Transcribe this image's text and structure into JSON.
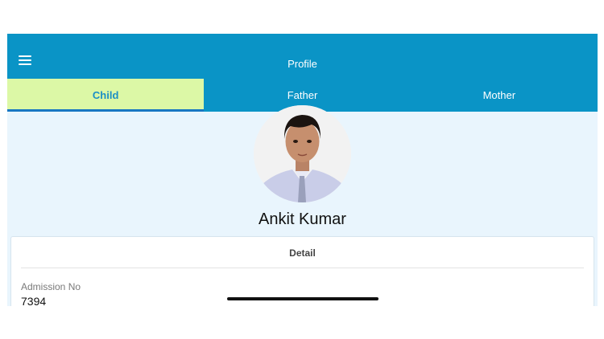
{
  "appbar": {
    "title": "Profile",
    "menu_icon": "hamburger-menu-icon"
  },
  "tabs": [
    {
      "label": "Child",
      "active": true
    },
    {
      "label": "Father",
      "active": false
    },
    {
      "label": "Mother",
      "active": false
    }
  ],
  "profile": {
    "name": "Ankit Kumar"
  },
  "detail_card": {
    "title": "Detail",
    "fields": [
      {
        "label": "Admission No",
        "value": "7394"
      }
    ]
  },
  "colors": {
    "primary": "#0a94c6",
    "active_tab_bg": "#dcf8a6",
    "active_tab_text": "#1a8fc6",
    "page_bg": "#e9f5fd"
  }
}
